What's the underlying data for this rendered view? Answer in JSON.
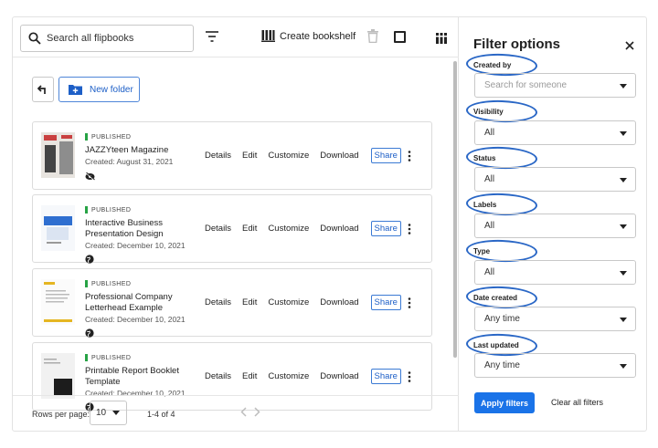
{
  "toolbar": {
    "search_placeholder": "Search all flipbooks",
    "create_bookshelf_label": "Create bookshelf"
  },
  "folder": {
    "new_folder_label": "New folder"
  },
  "flipbooks": [
    {
      "status": "PUBLISHED",
      "title": "JAZZYteen Magazine",
      "created": "Created: August 31, 2021",
      "visibility_icon": "eye-off-icon"
    },
    {
      "status": "PUBLISHED",
      "title": "Interactive Business Presentation Design",
      "created": "Created: December 10, 2021",
      "visibility_icon": "globe-icon"
    },
    {
      "status": "PUBLISHED",
      "title": "Professional Company Letterhead Example",
      "created": "Created: December 10, 2021",
      "visibility_icon": "globe-icon"
    },
    {
      "status": "PUBLISHED",
      "title": "Printable Report Booklet Template",
      "created": "Created: December 10, 2021",
      "visibility_icon": "globe-icon"
    }
  ],
  "row_actions": {
    "details": "Details",
    "edit": "Edit",
    "customize": "Customize",
    "download": "Download",
    "share": "Share"
  },
  "pagination": {
    "rows_per_page_label": "Rows per page:",
    "rows_per_page_value": "10",
    "range": "1-4 of 4"
  },
  "filter_panel": {
    "title": "Filter options",
    "created_by": {
      "label": "Created by",
      "placeholder": "Search for someone"
    },
    "visibility": {
      "label": "Visibility",
      "value": "All"
    },
    "status": {
      "label": "Status",
      "value": "All"
    },
    "labels": {
      "label": "Labels",
      "value": "All"
    },
    "type": {
      "label": "Type",
      "value": "All"
    },
    "date_created": {
      "label": "Date created",
      "value": "Any time"
    },
    "last_updated": {
      "label": "Last updated",
      "value": "Any time"
    },
    "apply_label": "Apply filters",
    "clear_label": "Clear all filters"
  },
  "colors": {
    "accent": "#1a73e8",
    "published": "#27a345",
    "annotation_ring": "#2a67c6"
  }
}
